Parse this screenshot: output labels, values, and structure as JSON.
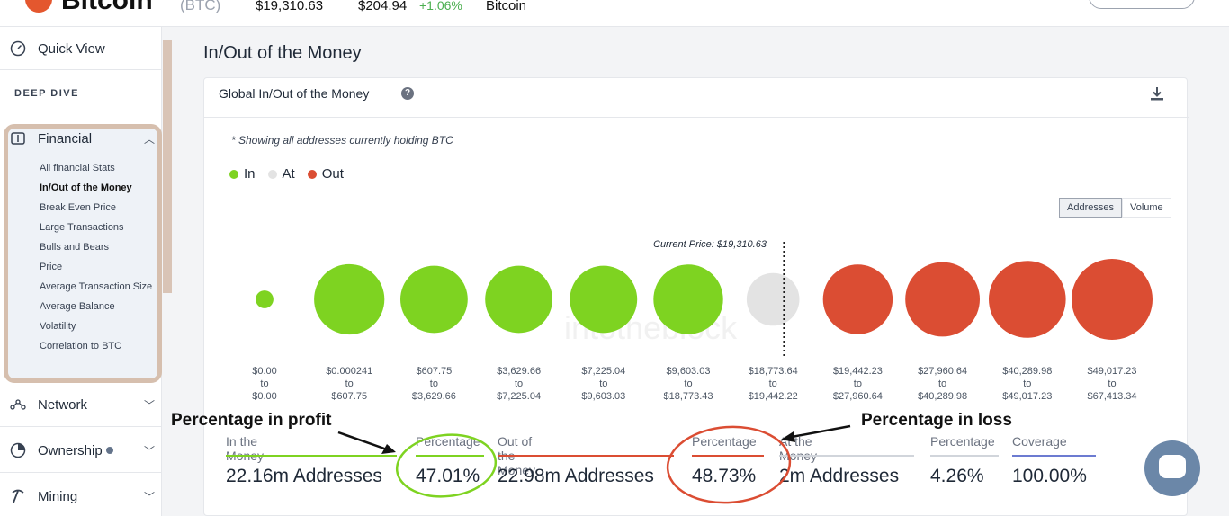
{
  "topbar": {
    "coin_name": "Bitcoin",
    "coin_symbol": "(BTC)",
    "price": "$19,310.63",
    "change_value": "$204.94",
    "change_percent": "+1.06%",
    "tag": "Bitcoin"
  },
  "sidebar": {
    "quick_view": "Quick View",
    "deep_dive": "DEEP DIVE",
    "financial": "Financial",
    "financial_items": [
      "All financial Stats",
      "In/Out of the Money",
      "Break Even Price",
      "Large Transactions",
      "Bulls and Bears",
      "Price",
      "Average Transaction Size",
      "Average Balance",
      "Volatility",
      "Correlation to BTC"
    ],
    "active_item": "In/Out of the Money",
    "network": "Network",
    "ownership": "Ownership",
    "mining": "Mining"
  },
  "page": {
    "title": "In/Out of the Money"
  },
  "card": {
    "title": "Global In/Out of the Money",
    "note": "* Showing all addresses currently holding BTC",
    "legend": [
      {
        "label": "In",
        "color": "#7ed321"
      },
      {
        "label": "At",
        "color": "#e3e3e3"
      },
      {
        "label": "Out",
        "color": "#db4d33"
      }
    ],
    "toggle": {
      "addresses": "Addresses",
      "volume": "Volume",
      "active": "Addresses"
    },
    "current_price": "Current Price: $19,310.63",
    "watermark": "intotheblock",
    "stats": {
      "in_label": "In the Money",
      "in_value": "22.16m Addresses",
      "in_pct_label": "Percentage",
      "in_pct_value": "47.01%",
      "out_label": "Out of the Money",
      "out_value": "22.98m Addresses",
      "out_pct_label": "Percentage",
      "out_pct_value": "48.73%",
      "at_label": "At the Money",
      "at_value": "2m Addresses",
      "at_pct_label": "Percentage",
      "at_pct_value": "4.26%",
      "coverage_label": "Coverage",
      "coverage_value": "100.00%"
    }
  },
  "chart_data": {
    "type": "scatter",
    "title": "Global In/Out of the Money",
    "buckets": [
      {
        "from": "$0.00",
        "to": "$0.00",
        "status": "in",
        "size": 0.22
      },
      {
        "from": "$0.000241",
        "to": "$607.75",
        "status": "in",
        "size": 0.87
      },
      {
        "from": "$607.75",
        "to": "$3,629.66",
        "status": "in",
        "size": 0.83
      },
      {
        "from": "$3,629.66",
        "to": "$7,225.04",
        "status": "in",
        "size": 0.83
      },
      {
        "from": "$7,225.04",
        "to": "$9,603.03",
        "status": "in",
        "size": 0.83
      },
      {
        "from": "$9,603.03",
        "to": "$18,773.43",
        "status": "in",
        "size": 0.86
      },
      {
        "from": "$18,773.64",
        "to": "$19,442.22",
        "status": "at",
        "size": 0.65
      },
      {
        "from": "$19,442.23",
        "to": "$27,960.64",
        "status": "out",
        "size": 0.86
      },
      {
        "from": "$27,960.64",
        "to": "$40,289.98",
        "status": "out",
        "size": 0.92
      },
      {
        "from": "$40,289.98",
        "to": "$49,017.23",
        "status": "out",
        "size": 0.95
      },
      {
        "from": "$49,017.23",
        "to": "$67,413.34",
        "status": "out",
        "size": 1.0
      }
    ],
    "range_joiner": "to",
    "colors": {
      "in": "#7ed321",
      "at": "#e3e3e3",
      "out": "#db4d33"
    }
  },
  "annotations": {
    "profit": "Percentage in profit",
    "loss": "Percentage in loss"
  }
}
